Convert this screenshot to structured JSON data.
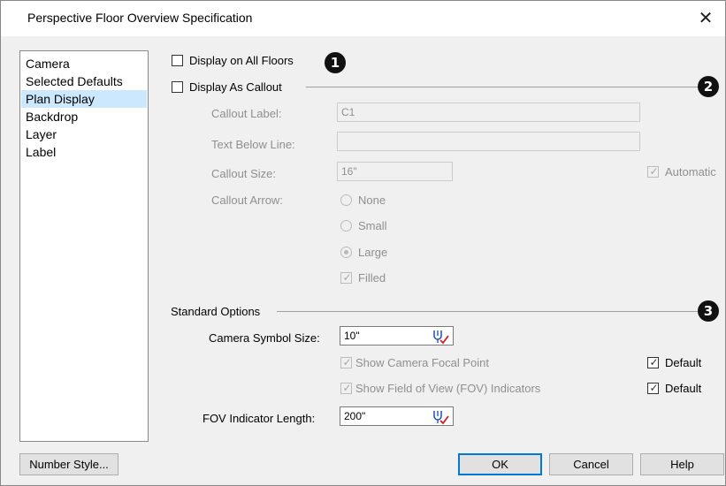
{
  "window": {
    "title": "Perspective Floor Overview Specification",
    "close_glyph": "✕"
  },
  "sidebar": {
    "items": [
      {
        "label": "Camera"
      },
      {
        "label": "Selected Defaults"
      },
      {
        "label": "Plan Display",
        "selected": true
      },
      {
        "label": "Backdrop"
      },
      {
        "label": "Layer"
      },
      {
        "label": "Label"
      }
    ]
  },
  "callouts": {
    "one": "1",
    "two": "2",
    "three": "3"
  },
  "display_all_floors": {
    "label": "Display on All Floors",
    "checked": false
  },
  "display_as_callout": {
    "label": "Display As Callout",
    "checked": false
  },
  "callout": {
    "label_label": "Callout Label:",
    "label_value": "C1",
    "text_below_label": "Text Below Line:",
    "text_below_value": "",
    "size_label": "Callout Size:",
    "size_value": "16\"",
    "automatic_label": "Automatic",
    "automatic_checked": true,
    "arrow_label": "Callout Arrow:",
    "arrow_options": [
      "None",
      "Small",
      "Large"
    ],
    "arrow_selected": "Large",
    "filled_label": "Filled",
    "filled_checked": true
  },
  "standard_options": {
    "heading": "Standard Options",
    "symbol_size_label": "Camera Symbol Size:",
    "symbol_size_value": "10\"",
    "show_focal_label": "Show Camera Focal Point",
    "show_focal_checked": true,
    "show_fov_label": "Show Field of View (FOV) Indicators",
    "show_fov_checked": true,
    "default_label": "Default",
    "focal_default_checked": true,
    "fov_default_checked": true,
    "fov_length_label": "FOV Indicator Length:",
    "fov_length_value": "200\""
  },
  "buttons": {
    "number_style": "Number Style...",
    "ok": "OK",
    "cancel": "Cancel",
    "help": "Help"
  },
  "colors": {
    "accent": "#0078d7",
    "selection": "#cce8ff",
    "dialog_bg": "#f0f0f0"
  }
}
